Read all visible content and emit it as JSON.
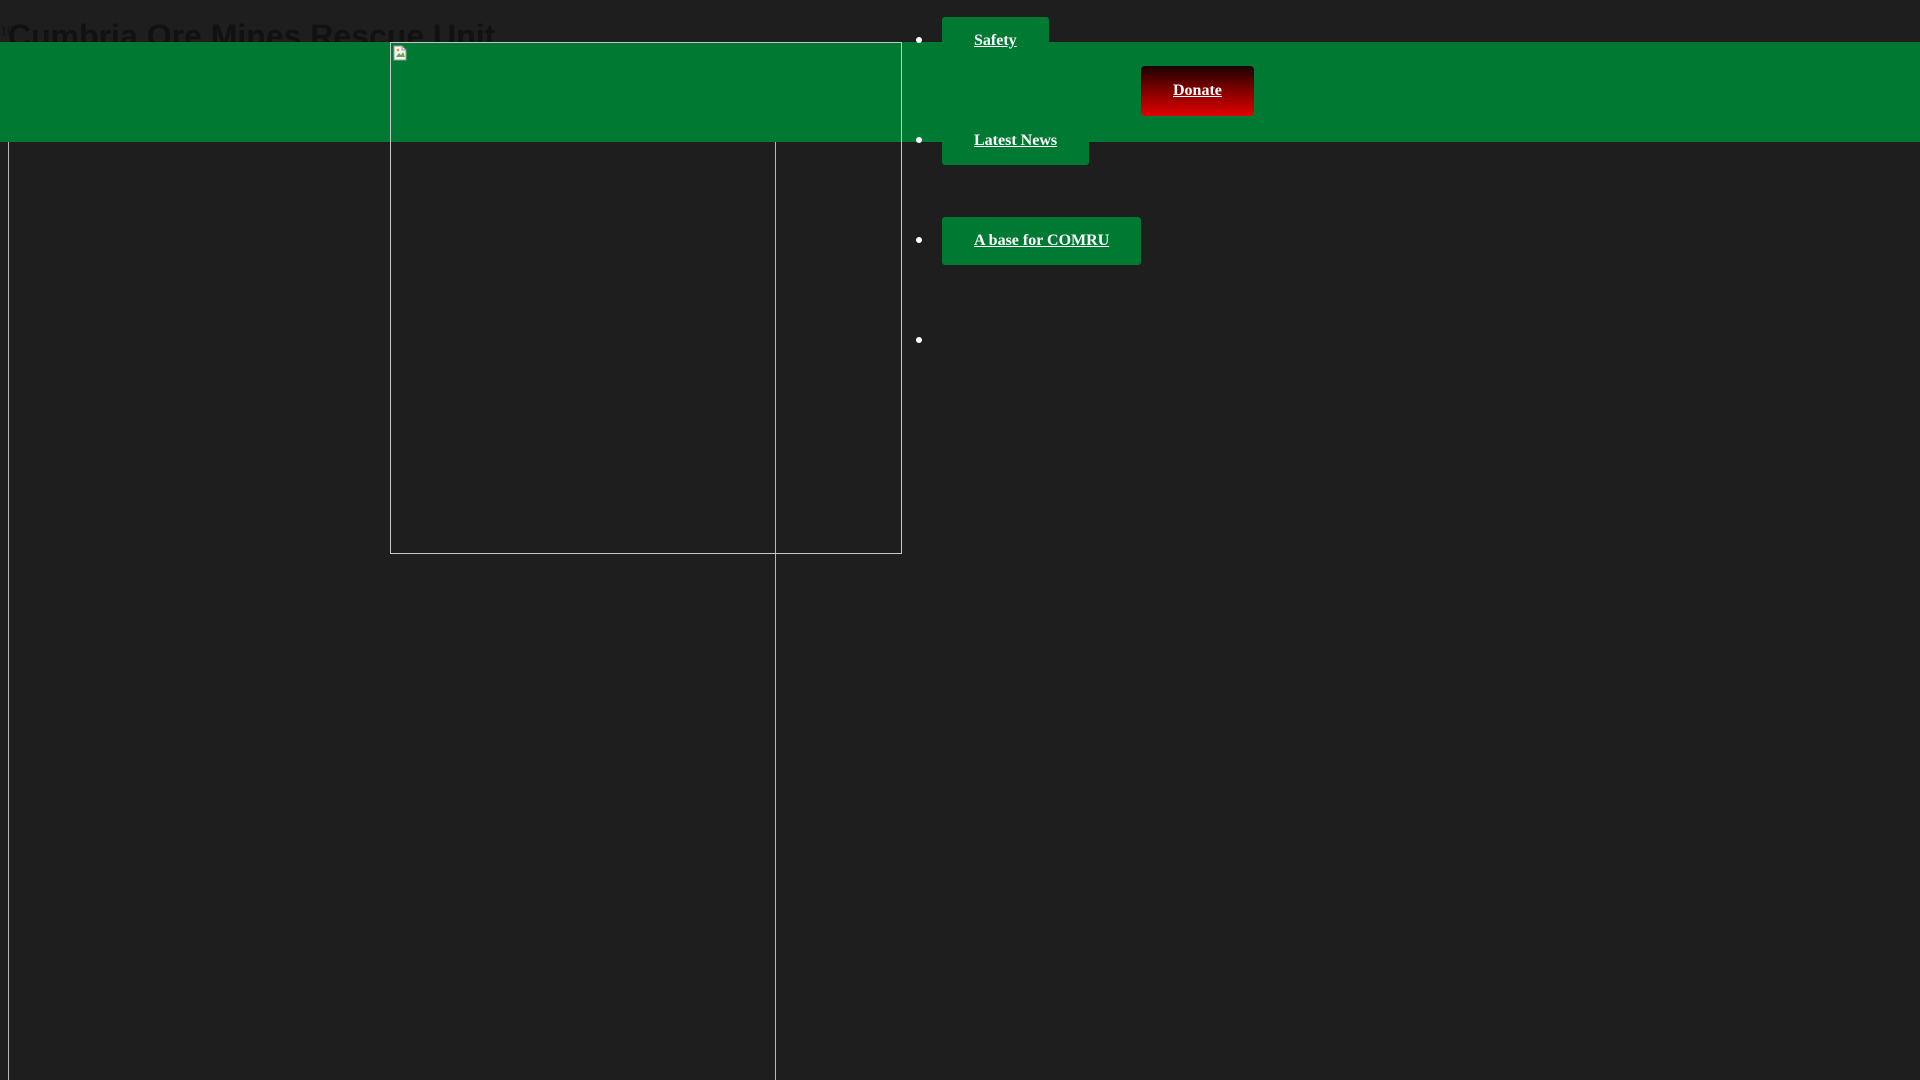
{
  "header": {
    "title": "Cumbria Ore Mines Rescue Unit",
    "small_text": "10"
  },
  "logo": {
    "alt": ""
  },
  "nav": {
    "items": [
      {
        "label": "Safety"
      },
      {
        "label": "Latest News"
      },
      {
        "label": "A base for COMRU"
      },
      {
        "label": ""
      }
    ]
  },
  "donate": {
    "label": "Donate"
  },
  "colors": {
    "background": "#1e1e1e",
    "brand_green": "#007a33",
    "donate_red": "#e00000",
    "link_text": "#ffffff"
  },
  "icons": {
    "logo_placeholder": "broken-image-icon"
  }
}
